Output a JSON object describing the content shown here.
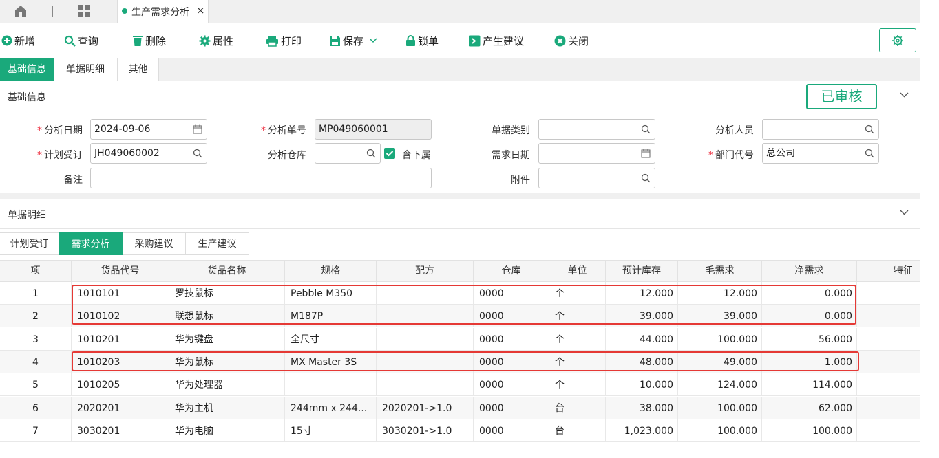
{
  "tabs": {
    "current": "生产需求分析"
  },
  "toolbar": {
    "add": "新增",
    "query": "查询",
    "delete": "删除",
    "props": "属性",
    "print": "打印",
    "save": "保存",
    "lock": "锁单",
    "suggest": "产生建议",
    "close": "关闭"
  },
  "section_tabs": [
    "基础信息",
    "单据明细",
    "其他"
  ],
  "basic": {
    "title": "基础信息",
    "status": "已审核",
    "labels": {
      "date": "分析日期",
      "no": "分析单号",
      "type": "单据类别",
      "person": "分析人员",
      "plan": "计划受订",
      "wh": "分析仓库",
      "sub": "含下属",
      "need_date": "需求日期",
      "dept": "部门代号",
      "remark": "备注",
      "attach": "附件"
    },
    "values": {
      "date": "2024-09-06",
      "no": "MP049060001",
      "plan": "JH049060002",
      "dept": "总公司"
    }
  },
  "detail": {
    "title": "单据明细",
    "tabs": [
      "计划受订",
      "需求分析",
      "采购建议",
      "生产建议"
    ],
    "columns": [
      "项",
      "货品代号",
      "货品名称",
      "规格",
      "配方",
      "仓库",
      "单位",
      "预计库存",
      "毛需求",
      "净需求",
      "特征"
    ],
    "rows": [
      [
        "1",
        "1010101",
        "罗技鼠标",
        "Pebble M350",
        "",
        "0000",
        "个",
        "12.000",
        "12.000",
        "0.000"
      ],
      [
        "2",
        "1010102",
        "联想鼠标",
        "M187P",
        "",
        "0000",
        "个",
        "39.000",
        "39.000",
        "0.000"
      ],
      [
        "3",
        "1010201",
        "华为键盘",
        "全尺寸",
        "",
        "0000",
        "个",
        "44.000",
        "100.000",
        "56.000"
      ],
      [
        "4",
        "1010203",
        "华为鼠标",
        "MX Master 3S",
        "",
        "0000",
        "个",
        "48.000",
        "49.000",
        "1.000"
      ],
      [
        "5",
        "1010205",
        "华为处理器",
        "",
        "",
        "0000",
        "个",
        "10.000",
        "124.000",
        "114.000"
      ],
      [
        "6",
        "2020201",
        "华为主机",
        "244mm x 244...",
        "2020201->1.0",
        "0000",
        "台",
        "38.000",
        "100.000",
        "62.000"
      ],
      [
        "7",
        "3030201",
        "华为电脑",
        "15寸",
        "3030201->1.0",
        "0000",
        "台",
        "1,023.000",
        "100.000",
        "100.000"
      ]
    ]
  },
  "colors": {
    "accent": "#1aa97b",
    "highlight": "#e53935"
  }
}
